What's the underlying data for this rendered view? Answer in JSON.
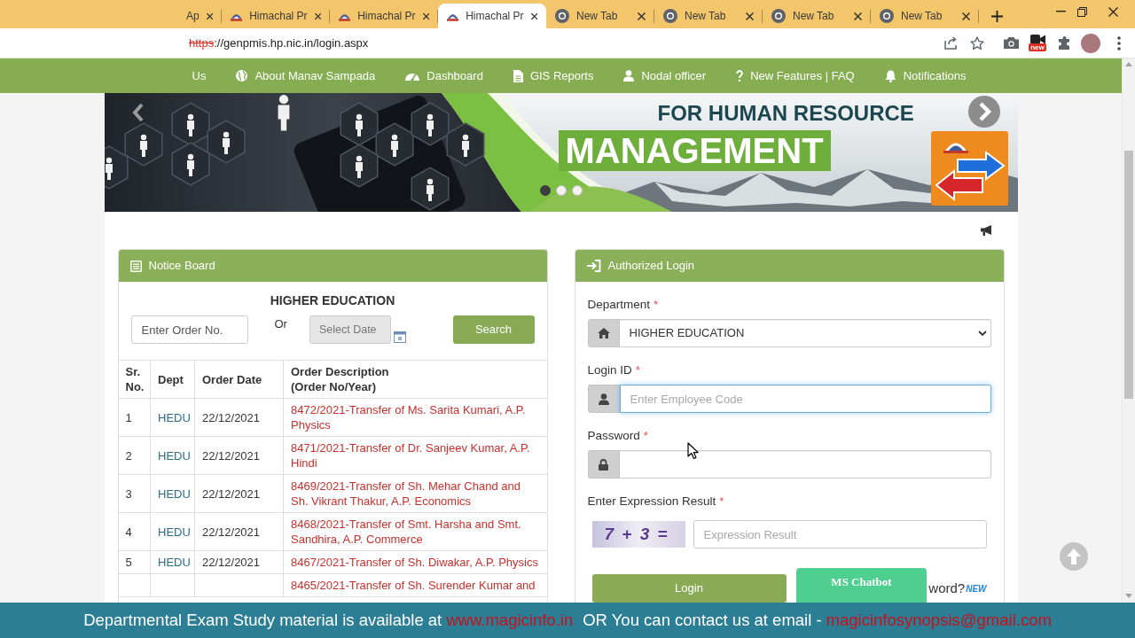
{
  "browser": {
    "tabs": [
      {
        "title": "Ap",
        "kind": "clipped",
        "selected": false
      },
      {
        "title": "Himachal Pr",
        "kind": "site",
        "selected": false
      },
      {
        "title": "Himachal Pr",
        "kind": "site",
        "selected": false
      },
      {
        "title": "Himachal Pr",
        "kind": "site",
        "selected": true
      },
      {
        "title": "New Tab",
        "kind": "newtab",
        "selected": false
      },
      {
        "title": "New Tab",
        "kind": "newtab",
        "selected": false
      },
      {
        "title": "New Tab",
        "kind": "newtab",
        "selected": false
      },
      {
        "title": "New Tab",
        "kind": "newtab",
        "selected": false
      }
    ],
    "address": {
      "scheme": "https",
      "rest": "://genpmis.hp.nic.in/login.aspx",
      "insecure": true
    },
    "extension_badge": "new"
  },
  "nav": [
    {
      "label": "Us"
    },
    {
      "label": "About Manav Sampada"
    },
    {
      "label": "Dashboard"
    },
    {
      "label": "GIS Reports"
    },
    {
      "label": "Nodal officer"
    },
    {
      "label": "New Features | FAQ"
    },
    {
      "label": "Notifications"
    }
  ],
  "banner": {
    "heading": "FOR HUMAN RESOURCE",
    "title": "MANAGEMENT",
    "slides": [
      {
        "selected": true
      },
      {
        "selected": false
      },
      {
        "selected": false
      }
    ]
  },
  "notice_board": {
    "title": "Notice Board",
    "department": "HIGHER EDUCATION",
    "order_field": {
      "placeholder": "Enter Order No."
    },
    "separator": "Or",
    "date_field": {
      "placeholder": "Select Date",
      "disabled": true
    },
    "search_button": "Search",
    "columns": [
      {
        "label": "Sr. No."
      },
      {
        "label": "Dept"
      },
      {
        "label": "Order Date"
      },
      {
        "label": "Order Description",
        "note": "(Order No/Year)"
      }
    ],
    "rows": [
      {
        "sr": "1",
        "dept": "HEDU",
        "date": "22/12/2021",
        "order": "8472/2021-Transfer of Ms. Sarita Kumari, A.P. Physics"
      },
      {
        "sr": "2",
        "dept": "HEDU",
        "date": "22/12/2021",
        "order": "8471/2021-Transfer of Dr. Sanjeev Kumar, A.P. Hindi"
      },
      {
        "sr": "3",
        "dept": "HEDU",
        "date": "22/12/2021",
        "order": "8469/2021-Transfer of Sh. Mehar Chand and Sh. Vikrant Thakur, A.P. Economics"
      },
      {
        "sr": "4",
        "dept": "HEDU",
        "date": "22/12/2021",
        "order": "8468/2021-Transfer of Smt. Harsha and Smt. Sandhira, A.P. Commerce"
      },
      {
        "sr": "5",
        "dept": "HEDU",
        "date": "22/12/2021",
        "order": "8467/2021-Transfer of Sh. Diwakar, A.P. Physics"
      },
      {
        "order": "8465/2021-Transfer of Sh. Surender Kumar and"
      }
    ]
  },
  "login": {
    "title": "Authorized Login",
    "fields": [
      {
        "kind": "select",
        "label": "Department",
        "required_mark": "*",
        "value": "HIGHER EDUCATION",
        "focused": false
      },
      {
        "kind": "text",
        "label": "Login ID",
        "required_mark": "*",
        "placeholder": "Enter Employee Code",
        "focused": true
      },
      {
        "kind": "password",
        "label": "Password",
        "required_mark": "*",
        "focused": false
      },
      {
        "kind": "captcha",
        "label": "Enter Expression Result",
        "required_mark": "*",
        "captcha": "7 + 3 =",
        "placeholder": "Expression Result",
        "focused": false
      }
    ],
    "login_button": "Login",
    "forgot_link": "word?",
    "new_badge": "NEW",
    "chatbot_button": "MS Chatbot"
  },
  "promo_banner": {
    "text": "Departmental Exam Study material is available at",
    "website": "www.magicinfo.in",
    "contact_text": "OR You can contact us at email -",
    "email": "magicinfosynopsis@gmail.com"
  }
}
